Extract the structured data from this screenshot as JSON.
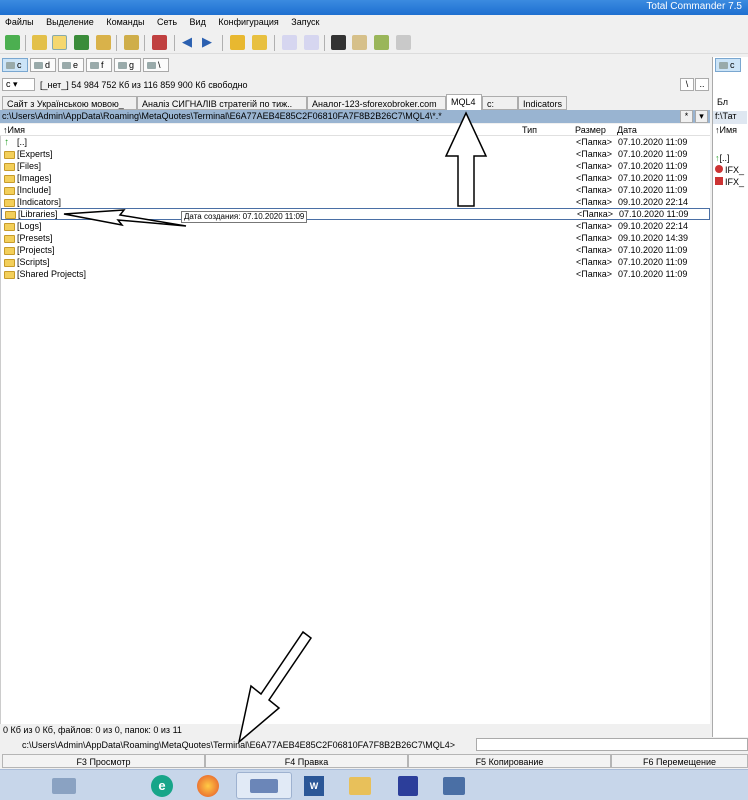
{
  "window": {
    "title": "Total Commander 7.5"
  },
  "menu": [
    "Файлы",
    "Выделение",
    "Команды",
    "Сеть",
    "Вид",
    "Конфигурация",
    "Запуск"
  ],
  "toolbar_icons": [
    "refresh-icon",
    "brief-view-icon",
    "detailed-view-icon",
    "thumbnail-view-icon",
    "tree-view-icon",
    "invert-selection-icon",
    "back-icon",
    "forward-icon",
    "archive-pack-icon",
    "archive-unpack-icon",
    "ftp-connect-icon",
    "url-connect-icon",
    "search-icon",
    "rename-tool-icon",
    "sync-dirs-icon",
    "notepad-icon"
  ],
  "drives": [
    "c",
    "d",
    "e",
    "f",
    "g",
    "\\"
  ],
  "drive_info": {
    "selected": "c",
    "label": "[_нет_]  54 984 752 Кб из 116 859 900 Кб свободно",
    "root_btn": "\\",
    "up_btn": ".."
  },
  "tabs": [
    "Сайт з Українською мовою_",
    "Аналіз СИГНАЛІВ стратегій по тиж..",
    "Аналог-123-sforexobroker.com",
    "MQL4",
    "c:",
    "Indicators"
  ],
  "path": "c:\\Users\\Admin\\AppData\\Roaming\\MetaQuotes\\Terminal\\E6A77AEB4E85C2F06810FA7F8B2B26C7\\MQL4\\*.*",
  "path_buttons": [
    "*",
    "▾"
  ],
  "columns": {
    "name": "Имя",
    "type": "Тип",
    "size": "Размер",
    "date": "Дата"
  },
  "rows": [
    {
      "name": "[..]",
      "size": "<Папка>",
      "date": "07.10.2020 11:09",
      "up": true
    },
    {
      "name": "[Experts]",
      "size": "<Папка>",
      "date": "07.10.2020 11:09"
    },
    {
      "name": "[Files]",
      "size": "<Папка>",
      "date": "07.10.2020 11:09"
    },
    {
      "name": "[Images]",
      "size": "<Папка>",
      "date": "07.10.2020 11:09"
    },
    {
      "name": "[Include]",
      "size": "<Папка>",
      "date": "07.10.2020 11:09"
    },
    {
      "name": "[Indicators]",
      "size": "<Папка>",
      "date": "09.10.2020 22:14"
    },
    {
      "name": "[Libraries]",
      "size": "<Папка>",
      "date": "07.10.2020 11:09",
      "focus": true
    },
    {
      "name": "[Logs]",
      "size": "<Папка>",
      "date": "09.10.2020 22:14"
    },
    {
      "name": "[Presets]",
      "size": "<Папка>",
      "date": "09.10.2020 14:39"
    },
    {
      "name": "[Projects]",
      "size": "<Папка>",
      "date": "07.10.2020 11:09"
    },
    {
      "name": "[Scripts]",
      "size": "<Папка>",
      "date": "07.10.2020 11:09"
    },
    {
      "name": "[Shared Projects]",
      "size": "<Папка>",
      "date": "07.10.2020 11:09"
    }
  ],
  "tooltip": "Дата создания: 07.10.2020 11:09",
  "status": "0 Кб из 0 Кб, файлов: 0 из 0, папок: 0 из 11",
  "cmdline": "c:\\Users\\Admin\\AppData\\Roaming\\MetaQuotes\\Terminal\\E6A77AEB4E85C2F06810FA7F8B2B26C7\\MQL4>",
  "fkeys": [
    "F3 Просмотр",
    "F4 Правка",
    "F5 Копирование",
    "F6 Перемещение"
  ],
  "right_pane": {
    "drive": "c",
    "tab": "Бл",
    "path": "f:\\Тат",
    "header": "Имя",
    "rows": [
      "[..]",
      "IFX_",
      "IFX_"
    ]
  },
  "taskbar_icons": [
    "explorer-icon",
    "eset-icon",
    "firefox-icon",
    "total-commander-icon",
    "word-icon",
    "file-manager-icon",
    "save-icon",
    "app-icon"
  ]
}
